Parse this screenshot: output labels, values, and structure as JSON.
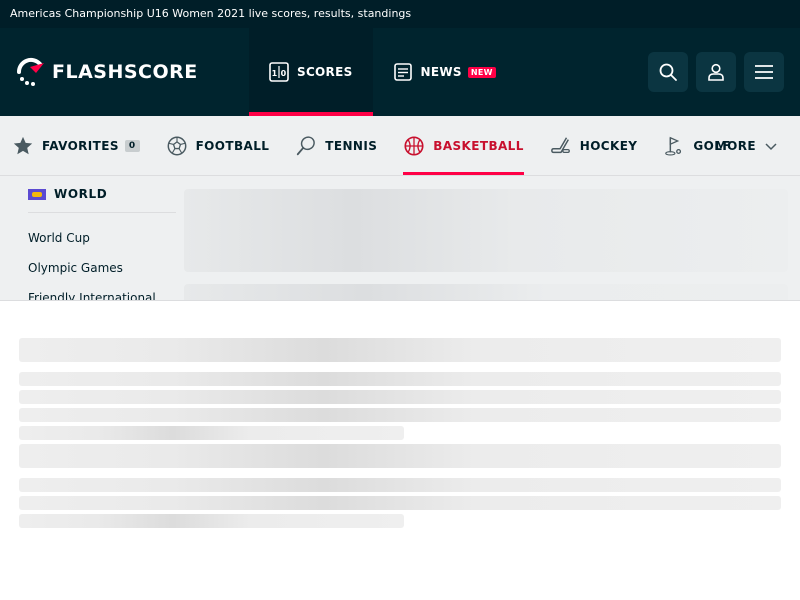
{
  "page_title": "Americas Championship U16 Women 2021 live scores, results, standings",
  "brand": {
    "name": "FLASHSCORE",
    "accent": "#ff0046",
    "header_bg": "#00242e"
  },
  "header": {
    "nav": [
      {
        "label": "SCORES",
        "icon": "scoreboard-icon",
        "active": true
      },
      {
        "label": "NEWS",
        "icon": "news-icon",
        "badge": "NEW"
      }
    ],
    "actions": [
      {
        "icon": "search-icon"
      },
      {
        "icon": "user-icon"
      },
      {
        "icon": "menu-icon"
      }
    ]
  },
  "sports": {
    "favorites": {
      "label": "FAVORITES",
      "count": "0"
    },
    "items": [
      {
        "label": "FOOTBALL",
        "icon": "football-icon"
      },
      {
        "label": "TENNIS",
        "icon": "tennis-icon"
      },
      {
        "label": "BASKETBALL",
        "icon": "basketball-icon",
        "active": true
      },
      {
        "label": "HOCKEY",
        "icon": "hockey-icon"
      },
      {
        "label": "GOLF",
        "icon": "golf-icon"
      }
    ],
    "more": "MORE"
  },
  "left_menu": {
    "region": "WORLD",
    "items": [
      "World Cup",
      "Olympic Games",
      "Friendly International"
    ]
  }
}
